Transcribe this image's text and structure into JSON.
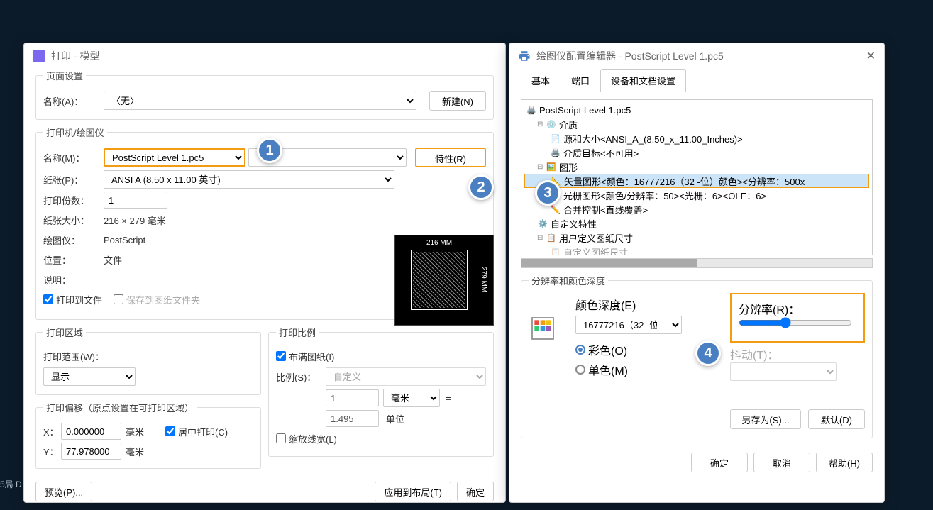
{
  "bg_text": "5局 D",
  "print_window": {
    "title": "打印 - 模型",
    "page_setup": {
      "legend": "页面设置",
      "name_label": "名称(A)：",
      "name_value": "〈无〉",
      "new_btn": "新建(N)"
    },
    "printer": {
      "legend": "打印机/绘图仪",
      "name_label": "名称(M)：",
      "name_value": "PostScript Level 1.pc5",
      "props_btn": "特性(R)",
      "paper_label": "纸张(P)：",
      "paper_value": "ANSI A (8.50 x 11.00 英寸)",
      "copies_label": "打印份数：",
      "copies_value": "1",
      "size_label": "纸张大小：",
      "size_value": "216 × 279  毫米",
      "plotter_label": "绘图仪：",
      "plotter_value": "PostScript",
      "location_label": "位置：",
      "location_value": "文件",
      "desc_label": "说明：",
      "to_file": "打印到文件",
      "save_folder": "保存到图纸文件夹"
    },
    "preview": {
      "width": "216 MM",
      "height": "279 MM"
    },
    "area": {
      "legend": "打印区域",
      "range_label": "打印范围(W)：",
      "range_value": "显示"
    },
    "scale": {
      "legend": "打印比例",
      "fit": "布满图纸(I)",
      "ratio_label": "比例(S)：",
      "ratio_value": "自定义",
      "val1": "1",
      "unit1": "毫米",
      "eq": "=",
      "val2": "1.495",
      "unit2": "单位",
      "scale_lw": "缩放线宽(L)"
    },
    "offset": {
      "legend": "打印偏移（原点设置在可打印区域）",
      "x_label": "X：",
      "x_value": "0.000000",
      "y_label": "Y：",
      "y_value": "77.978000",
      "unit": "毫米",
      "center": "居中打印(C)"
    },
    "buttons": {
      "preview": "预览(P)...",
      "apply": "应用到布局(T)",
      "ok": "确定"
    }
  },
  "config_window": {
    "title": "绘图仪配置编辑器 - PostScript Level 1.pc5",
    "tabs": {
      "basic": "基本",
      "port": "端口",
      "device": "设备和文档设置"
    },
    "tree": {
      "root": "PostScript Level 1.pc5",
      "media": "介质",
      "source": "源和大小<ANSI_A_(8.50_x_11.00_Inches)>",
      "target": "介质目标<不可用>",
      "graphics": "图形",
      "vector": "矢量图形<颜色：16777216（32 -位）颜色><分辨率：500x",
      "raster": "光栅图形<颜色/分辨率：50><光栅：6><OLE：6>",
      "merge": "合并控制<直线覆盖>",
      "custom": "自定义特性",
      "user_size": "用户定义图纸尺寸",
      "overflow": "自定义图纸尺寸"
    },
    "resolution": {
      "legend": "分辨率和颜色深度",
      "depth_label": "颜色深度(E)",
      "depth_value": "16777216（32 -位",
      "res_label": "分辨率(R)：",
      "color_radio": "彩色(O)",
      "mono_radio": "单色(M)",
      "dither_label": "抖动(T)："
    },
    "buttons": {
      "saveas": "另存为(S)...",
      "default": "默认(D)",
      "ok": "确定",
      "cancel": "取消",
      "help": "帮助(H)"
    }
  },
  "callouts": {
    "c1": "1",
    "c2": "2",
    "c3": "3",
    "c4": "4"
  }
}
